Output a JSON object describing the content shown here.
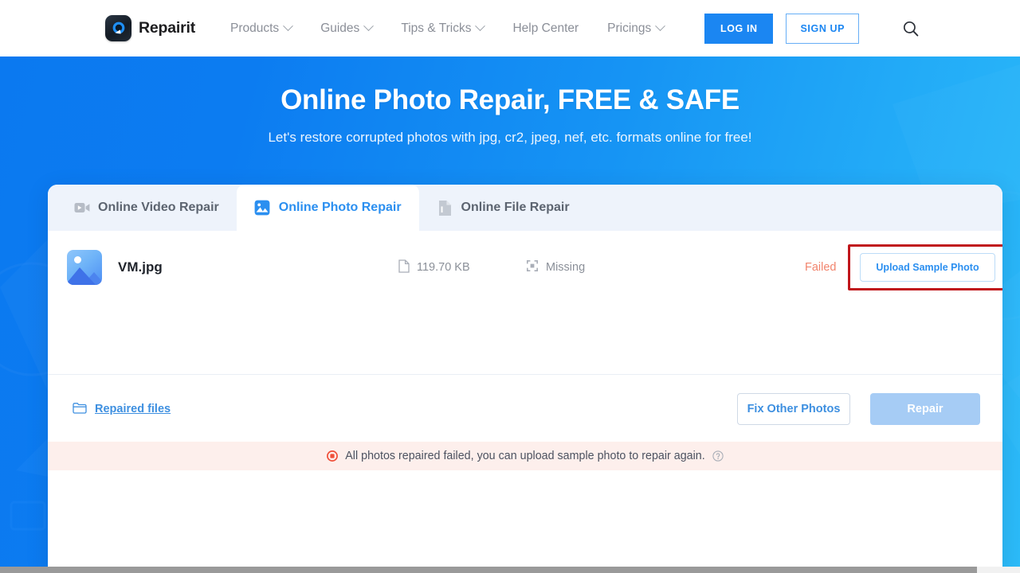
{
  "nav": {
    "logo_text": "Repairit",
    "logo_icon": "repairit-logo-icon",
    "links": [
      {
        "label": "Products",
        "has_caret": true
      },
      {
        "label": "Guides",
        "has_caret": true
      },
      {
        "label": "Tips & Tricks",
        "has_caret": true
      },
      {
        "label": "Help Center",
        "has_caret": false
      },
      {
        "label": "Pricings",
        "has_caret": true
      }
    ],
    "login_label": "LOG IN",
    "signup_label": "SIGN UP",
    "search_icon": "search-icon"
  },
  "hero": {
    "title": "Online Photo Repair, FREE & SAFE",
    "subtitle": "Let's restore corrupted photos with jpg, cr2, jpeg, nef, etc. formats online for free!",
    "gradient_from": "#0b79f0",
    "gradient_to": "#2cbcf9"
  },
  "tabs": [
    {
      "label": "Online Video Repair",
      "icon": "video-camera-icon",
      "active": false
    },
    {
      "label": "Online Photo Repair",
      "icon": "photo-image-icon",
      "active": true
    },
    {
      "label": "Online File Repair",
      "icon": "file-document-icon",
      "active": false
    }
  ],
  "file_row": {
    "thumb_icon": "image-thumbnail-icon",
    "name": "VM.jpg",
    "size_icon": "file-icon",
    "size": "119.70 KB",
    "resolution_icon": "resolution-icon",
    "resolution": "Missing",
    "status": "Failed",
    "status_color": "#f2846d",
    "upload_sample_label": "Upload Sample Photo",
    "highlight_color": "#c0161b",
    "close_icon": "close-icon"
  },
  "footer": {
    "repaired_files_label": "Repaired files",
    "folder_icon": "folder-icon",
    "fix_other_label": "Fix Other Photos",
    "repair_label": "Repair",
    "repair_disabled": true
  },
  "error_banner": {
    "icon": "error-circle-icon",
    "message": "All photos repaired failed, you can upload sample photo to repair again.",
    "help_icon": "help-question-icon",
    "background": "#fdefec"
  },
  "scrollbar": {
    "name": "horizontal-scrollbar"
  }
}
